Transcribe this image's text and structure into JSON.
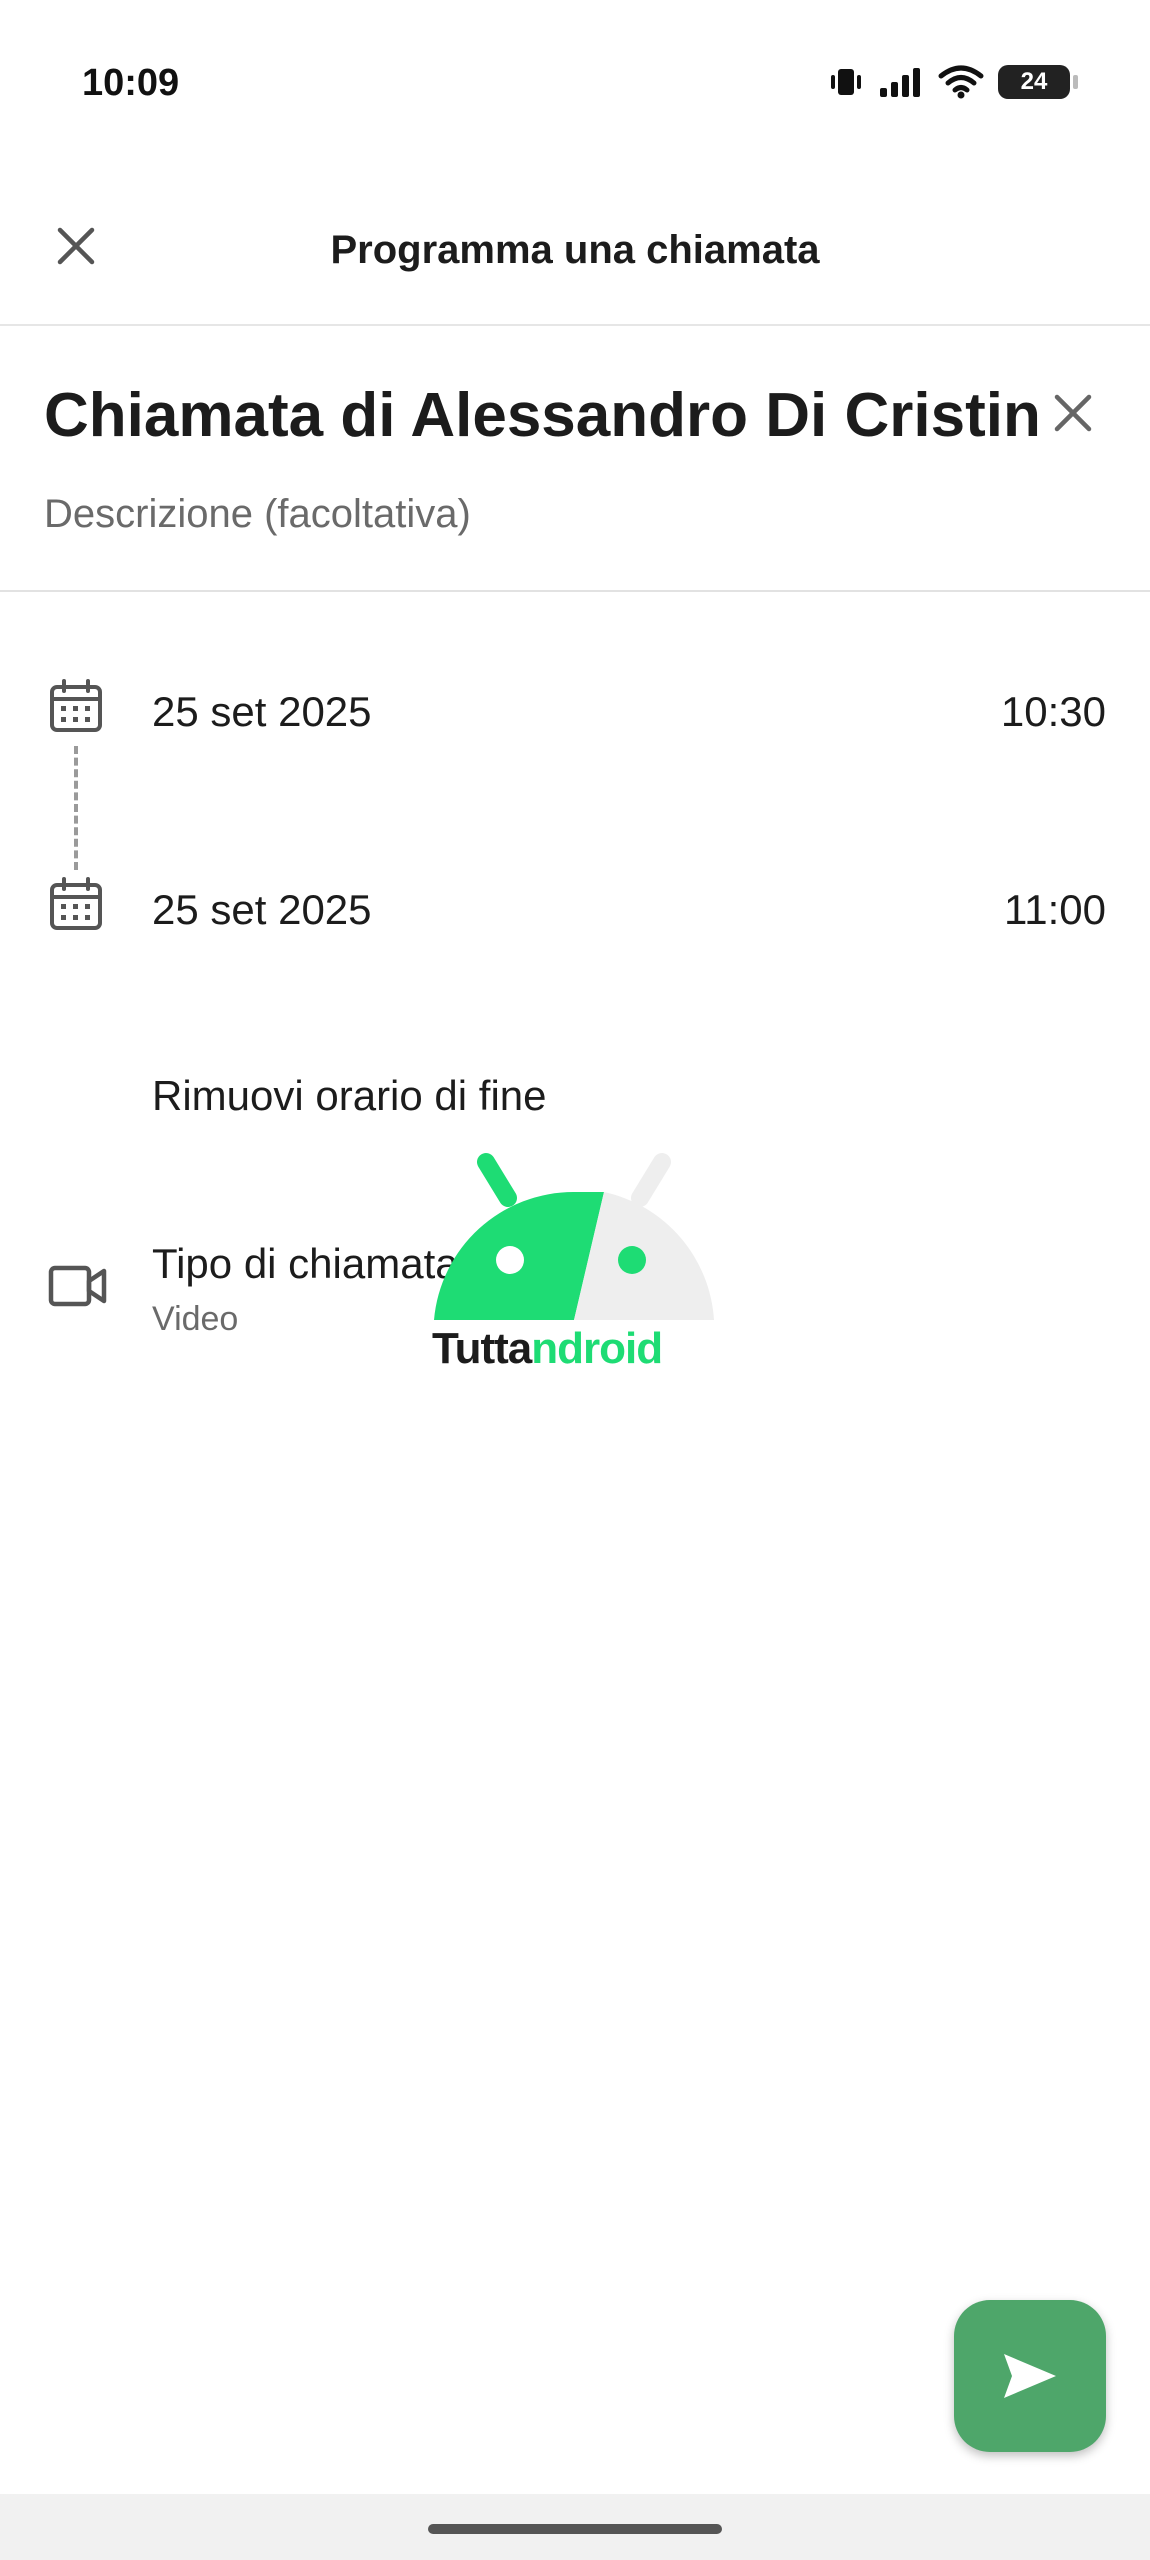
{
  "status_bar": {
    "time": "10:09",
    "battery_level": "24",
    "icons": [
      "vibrate-icon",
      "signal-icon",
      "wifi-icon",
      "battery-icon"
    ]
  },
  "header": {
    "title": "Programma una chiamata",
    "close_icon": "close-icon"
  },
  "event": {
    "title": "Chiamata di Alessandro Di Cristina",
    "description_placeholder": "Descrizione (facoltativa)"
  },
  "schedule": {
    "start": {
      "date": "25 set 2025",
      "time": "10:30"
    },
    "end": {
      "date": "25 set 2025",
      "time": "11:00"
    },
    "remove_end_label": "Rimuovi orario di fine"
  },
  "call_type": {
    "label": "Tipo di chiamata",
    "value": "Video"
  },
  "watermark": {
    "text_dark": "Tutta",
    "text_green": "ndroid"
  },
  "colors": {
    "accent": "#4ea66a",
    "watermark_green": "#1edc74"
  }
}
